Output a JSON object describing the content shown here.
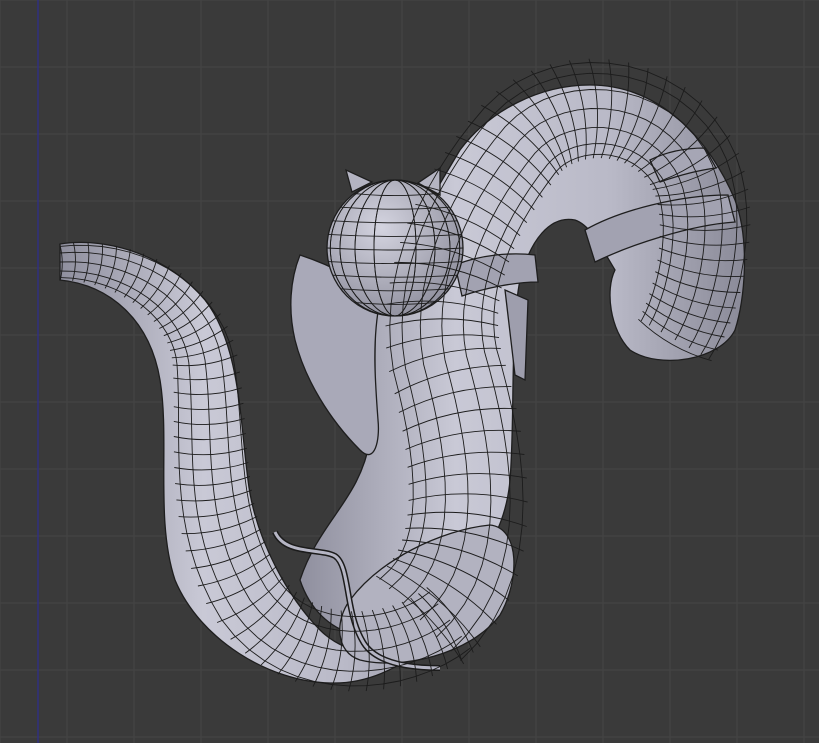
{
  "viewport": {
    "background_color": "#3a3a3a",
    "grid_color": "#454545",
    "axis_line_color": "#2d2d8f",
    "mesh_color": "#b8b8c6",
    "wire_color": "#1c1c1c",
    "show_grid": true,
    "shading": "solid-with-wireframe"
  }
}
